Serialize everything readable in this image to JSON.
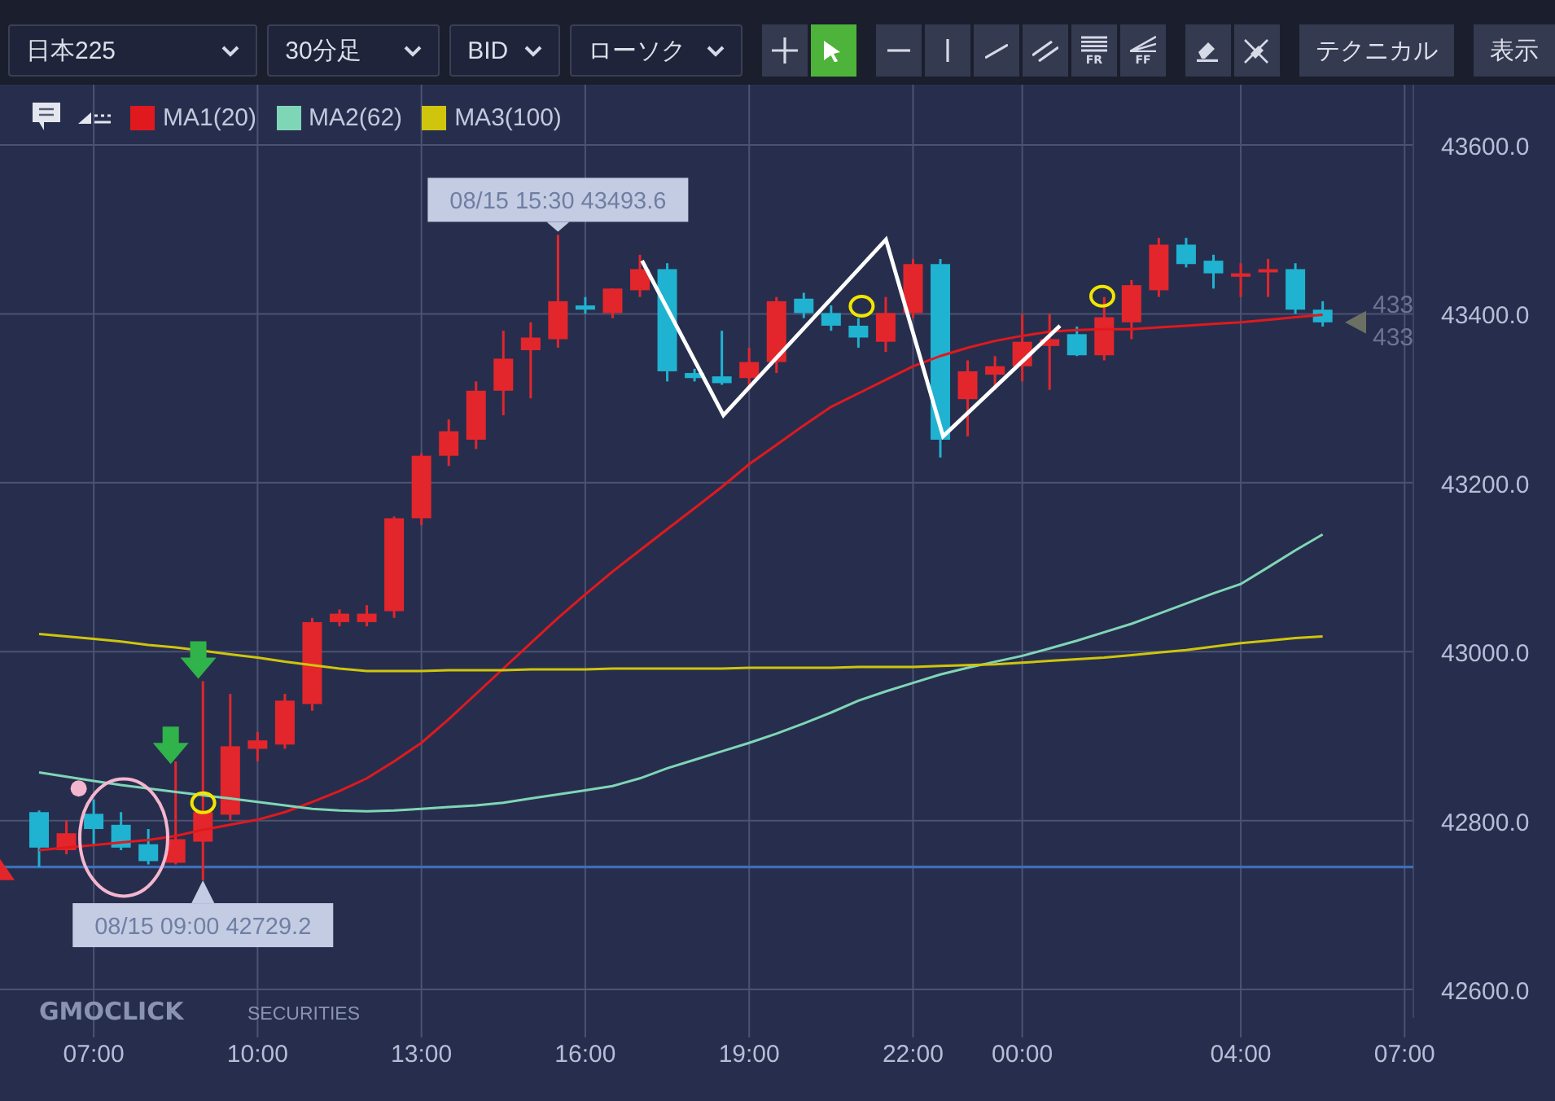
{
  "toolbar": {
    "dropdowns": [
      {
        "label": "日本225"
      },
      {
        "label": "30分足"
      },
      {
        "label": "BID"
      },
      {
        "label": "ローソク"
      }
    ],
    "tool_groups": [
      [
        {
          "kind": "crosshair",
          "selected": false
        },
        {
          "kind": "pointer",
          "selected": true
        }
      ],
      [
        {
          "kind": "hline",
          "selected": false
        },
        {
          "kind": "vline",
          "selected": false
        },
        {
          "kind": "trendline",
          "selected": false
        },
        {
          "kind": "channel",
          "selected": false
        },
        {
          "kind": "fib",
          "label": "FR",
          "selected": false
        },
        {
          "kind": "fan",
          "label": "FF",
          "selected": false
        }
      ],
      [
        {
          "kind": "eraser",
          "selected": false
        },
        {
          "kind": "eraser_all",
          "selected": false
        }
      ]
    ],
    "buttons": [
      "テクニカル",
      "表示"
    ]
  },
  "chart": {
    "logo": {
      "name": "GMOCLICK",
      "suffix": "SECURITIES"
    },
    "current_price_labels": [
      "433",
      "433"
    ],
    "chart_data": {
      "type": "candlestick",
      "grid": true,
      "ylim": [
        42566.3,
        43671.4
      ],
      "categories": [
        null,
        null,
        "07:00",
        null,
        null,
        null,
        null,
        null,
        "10:00",
        null,
        null,
        null,
        null,
        null,
        "13:00",
        null,
        null,
        null,
        null,
        null,
        "16:00",
        null,
        null,
        null,
        null,
        null,
        "19:00",
        null,
        null,
        null,
        null,
        null,
        "22:00",
        null,
        null,
        null,
        "00:00",
        null,
        null,
        null,
        null,
        null,
        null,
        null,
        "04:00",
        null,
        null,
        null,
        null,
        null,
        "07:00"
      ],
      "yticks": [
        {
          "value": 42600,
          "label": "42600.0"
        },
        {
          "value": 42800,
          "label": "42800.0"
        },
        {
          "value": 43000,
          "label": "43000.0"
        },
        {
          "value": 43200,
          "label": "43200.0"
        },
        {
          "value": 43400,
          "label": "43400.0"
        },
        {
          "value": 43600,
          "label": "43600.0"
        }
      ],
      "ohlc": [
        [
          42810,
          42812,
          42745,
          42768
        ],
        [
          42765,
          42800,
          42760,
          42785
        ],
        [
          42808,
          42825,
          42770,
          42790
        ],
        [
          42795,
          42810,
          42765,
          42768
        ],
        [
          42772,
          42790,
          42748,
          42752
        ],
        [
          42750,
          42870,
          42748,
          42778
        ],
        [
          42775,
          42965,
          42729.2,
          42810
        ],
        [
          42807,
          42950,
          42800,
          42888
        ],
        [
          42885,
          42905,
          42870,
          42895
        ],
        [
          42890,
          42950,
          42885,
          42942
        ],
        [
          42938,
          43040,
          42930,
          43035
        ],
        [
          43035,
          43050,
          43030,
          43045
        ],
        [
          43035,
          43055,
          43030,
          43045
        ],
        [
          43048,
          43160,
          43040,
          43158
        ],
        [
          43158,
          43235,
          43150,
          43232
        ],
        [
          43232,
          43275,
          43220,
          43261
        ],
        [
          43251,
          43320,
          43240,
          43309
        ],
        [
          43309,
          43380,
          43280,
          43347
        ],
        [
          43357,
          43390,
          43300,
          43372
        ],
        [
          43370,
          43493.6,
          43360,
          43415
        ],
        [
          43410,
          43420,
          43400,
          43405
        ],
        [
          43401,
          43430,
          43395,
          43430
        ],
        [
          43428,
          43470,
          43420,
          43453
        ],
        [
          43453,
          43460,
          43320,
          43332
        ],
        [
          43330,
          43335,
          43320,
          43324
        ],
        [
          43326,
          43380,
          43316,
          43318
        ],
        [
          43324,
          43360,
          43310,
          43343
        ],
        [
          43343,
          43420,
          43330,
          43415
        ],
        [
          43418,
          43425,
          43395,
          43401
        ],
        [
          43401,
          43410,
          43380,
          43386
        ],
        [
          43386,
          43395,
          43360,
          43372
        ],
        [
          43367,
          43420,
          43355,
          43401
        ],
        [
          43401,
          43465,
          43395,
          43459
        ],
        [
          43459,
          43465,
          43230,
          43251
        ],
        [
          43299,
          43345,
          43255,
          43332
        ],
        [
          43328,
          43350,
          43310,
          43338
        ],
        [
          43338,
          43400,
          43320,
          43367
        ],
        [
          43362,
          43400,
          43310,
          43370
        ],
        [
          43376,
          43385,
          43350,
          43351
        ],
        [
          43351,
          43420,
          43345,
          43396
        ],
        [
          43390,
          43440,
          43370,
          43434
        ],
        [
          43428,
          43490,
          43420,
          43482
        ],
        [
          43482,
          43490,
          43455,
          43459
        ],
        [
          43463,
          43470,
          43430,
          43448
        ],
        [
          43444,
          43460,
          43420,
          43448
        ],
        [
          43450,
          43465,
          43420,
          43453
        ],
        [
          43453,
          43460,
          43400,
          43405
        ],
        [
          43405,
          43415,
          43385,
          43390
        ],
        null,
        null,
        null
      ],
      "series": [
        {
          "name": "MA1(20)",
          "type": "line",
          "color": "#e0191e",
          "values": [
            42765,
            42768,
            42771,
            42774,
            42777,
            42782,
            42789,
            42795,
            42801,
            42810,
            42822,
            42835,
            42850,
            42870,
            42892,
            42920,
            42950,
            42980,
            43010,
            43040,
            43068,
            43095,
            43120,
            43145,
            43170,
            43195,
            43222,
            43245,
            43268,
            43290,
            43306,
            43322,
            43338,
            43350,
            43360,
            43368,
            43374,
            43379,
            43381,
            43382,
            43382,
            43384,
            43386,
            43388,
            43390,
            43393,
            43396,
            43399,
            null,
            null,
            null
          ]
        },
        {
          "name": "MA2(62)",
          "type": "line",
          "color": "#7fd6b6",
          "values": [
            42857,
            42852,
            42847,
            42842,
            42838,
            42834,
            42830,
            42826,
            42822,
            42818,
            42814,
            42812,
            42811,
            42812,
            42814,
            42816,
            42818,
            42821,
            42826,
            42831,
            42836,
            42841,
            42850,
            42862,
            42872,
            42882,
            42892,
            42903,
            42915,
            42928,
            42942,
            42953,
            42963,
            42973,
            42981,
            42988,
            42995,
            43004,
            43013,
            43023,
            43033,
            43045,
            43057,
            43069,
            43080,
            43100,
            43120,
            43139,
            null,
            null,
            null
          ]
        },
        {
          "name": "MA3(100)",
          "type": "line",
          "color": "#cfc50c",
          "values": [
            43021,
            43018,
            43015,
            43012,
            43008,
            43005,
            null,
            42997,
            42993,
            42988,
            42984,
            42980,
            42977,
            42977,
            42977,
            42978,
            42978,
            42978,
            42979,
            42979,
            42979,
            42980,
            42980,
            42980,
            42980,
            42980,
            42981,
            42981,
            42981,
            42981,
            42982,
            42982,
            42982,
            42983,
            42984,
            42985,
            42987,
            42989,
            42991,
            42993,
            42996,
            42999,
            43002,
            43006,
            43010,
            43013,
            43016,
            43018,
            null,
            null,
            null
          ]
        }
      ],
      "ref_lines": [
        {
          "axis": "y",
          "value": 42745
        }
      ],
      "annotations": [
        "08/15 15:30 43493.6",
        "08/15 09:00 42729.2"
      ]
    }
  }
}
